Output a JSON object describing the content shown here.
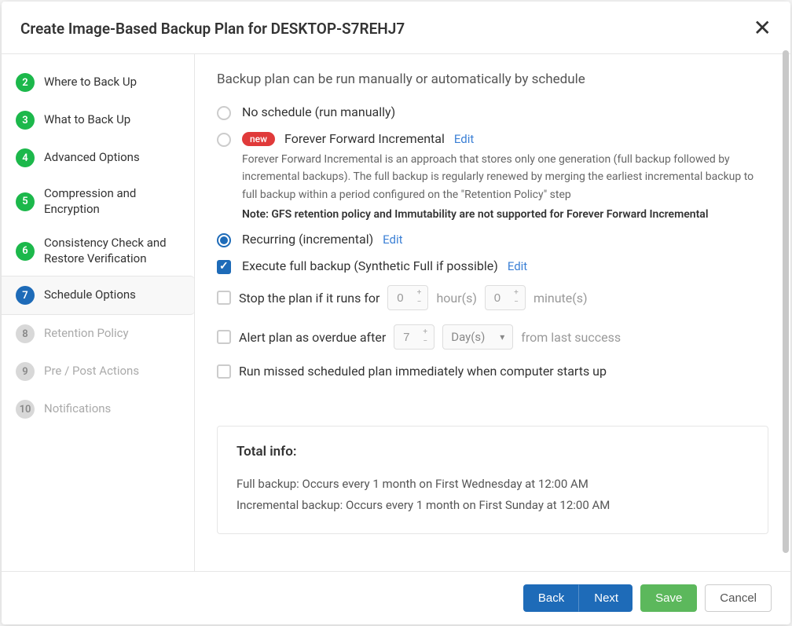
{
  "modal": {
    "title": "Create Image-Based Backup Plan for DESKTOP-S7REHJ7"
  },
  "steps": [
    {
      "num": "2",
      "label": "Where to Back Up",
      "state": "done"
    },
    {
      "num": "3",
      "label": "What to Back Up",
      "state": "done"
    },
    {
      "num": "4",
      "label": "Advanced Options",
      "state": "done"
    },
    {
      "num": "5",
      "label": "Compression and Encryption",
      "state": "done"
    },
    {
      "num": "6",
      "label": "Consistency Check and Restore Verification",
      "state": "done"
    },
    {
      "num": "7",
      "label": "Schedule Options",
      "state": "current"
    },
    {
      "num": "8",
      "label": "Retention Policy",
      "state": "pending"
    },
    {
      "num": "9",
      "label": "Pre / Post Actions",
      "state": "pending"
    },
    {
      "num": "10",
      "label": "Notifications",
      "state": "pending"
    }
  ],
  "content": {
    "heading": "Backup plan can be run manually or automatically by schedule",
    "no_schedule_label": "No schedule (run manually)",
    "ffi": {
      "badge": "new",
      "label": "Forever Forward Incremental",
      "edit": "Edit",
      "desc": "Forever Forward Incremental is an approach that stores only one generation (full backup followed by incremental backups). The full backup is regularly renewed by merging the earliest incremental backup to full backup within a period configured on the \"Retention Policy\" step",
      "note": "Note: GFS retention policy and Immutability are not supported for Forever Forward Incremental"
    },
    "recurring": {
      "label": "Recurring (incremental)",
      "edit": "Edit"
    },
    "full_backup": {
      "label": "Execute full backup (Synthetic Full if possible)",
      "edit": "Edit"
    },
    "stop_plan": {
      "label": "Stop the plan if it runs for",
      "hours": "0",
      "hours_unit": "hour(s)",
      "minutes": "0",
      "minutes_unit": "minute(s)"
    },
    "overdue": {
      "label": "Alert plan as overdue after",
      "value": "7",
      "unit": "Day(s)",
      "suffix": "from last success"
    },
    "run_missed": {
      "label": "Run missed scheduled plan immediately when computer starts up"
    },
    "total": {
      "title": "Total info:",
      "full": "Full backup: Occurs every 1 month on First Wednesday at 12:00 AM",
      "incr": "Incremental backup: Occurs every 1 month on First Sunday at 12:00 AM"
    }
  },
  "footer": {
    "back": "Back",
    "next": "Next",
    "save": "Save",
    "cancel": "Cancel"
  }
}
